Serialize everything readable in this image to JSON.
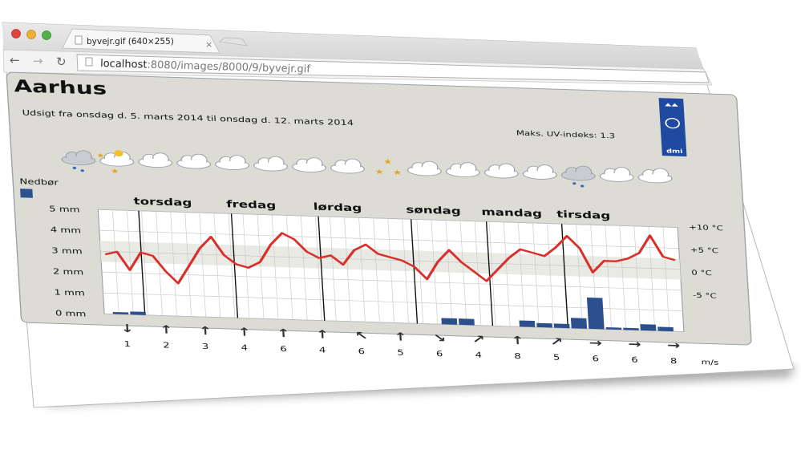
{
  "browser": {
    "tab_title": "byvejr.gif (640×255)",
    "tab_close": "×",
    "url_host": "localhost",
    "url_path": ":8080/images/8000/9/byvejr.gif"
  },
  "forecast": {
    "city": "Aarhus",
    "subtitle": "Udsigt fra onsdag d. 5. marts 2014 til onsdag d. 12. marts 2014",
    "uv": "Maks. UV-indeks: 1.3",
    "logo_text": "dmi",
    "precip_label": "Nedbør",
    "wind_unit": "m/s",
    "days": [
      "torsdag",
      "fredag",
      "lørdag",
      "søndag",
      "mandag",
      "tirsdag"
    ],
    "weather_icons": [
      "rain-cloud-icon",
      "moon-cloud-icon",
      "cloud-icon",
      "cloud-icon",
      "cloud-icon",
      "cloud-icon",
      "cloud-icon",
      "cloud-icon",
      "stars-icon",
      "cloud-icon",
      "cloud-icon",
      "cloud-icon",
      "cloud-icon",
      "rain-cloud-icon",
      "cloud-icon",
      "cloud-icon"
    ],
    "colors": {
      "temp_line": "#d9302c",
      "precip_bar": "#2c4f8e",
      "panel": "#dcdcd5",
      "logo_bg": "#1f4aa0"
    }
  },
  "chart_data": {
    "type": "bar",
    "title": "",
    "left_axis": {
      "label": "Nedbør",
      "ticks": [
        "5 mm",
        "4 mm",
        "3 mm",
        "2 mm",
        "1 mm",
        "0 mm"
      ],
      "range": [
        0,
        5
      ]
    },
    "right_axis": {
      "ticks": [
        "+10 °C",
        "+5 °C",
        "0 °C",
        "-5 °C"
      ],
      "range": [
        -7.5,
        10
      ]
    },
    "precipitation_mm": [
      0,
      0.1,
      0,
      0.15,
      0,
      0,
      0,
      0,
      0,
      0,
      0,
      0,
      0,
      0,
      0,
      0,
      0,
      0,
      0,
      0,
      0,
      0,
      0,
      0,
      0,
      0,
      0,
      0,
      0,
      0,
      0,
      0,
      0,
      0,
      0,
      0,
      0,
      0,
      0,
      0.3,
      0,
      0.3,
      0,
      0,
      0,
      0,
      0,
      0,
      0.3,
      0,
      0.2,
      0,
      0.2,
      0,
      0.5,
      0,
      1.5,
      0,
      0.1,
      0,
      0.1,
      0,
      0.3,
      0,
      0.2,
      0,
      0
    ],
    "series": [
      {
        "name": "temperature",
        "values": [
          2.5,
          3,
          0,
          3,
          2.5,
          0,
          -2,
          1,
          4,
          6,
          3,
          1.5,
          1,
          2,
          5,
          7,
          6,
          4,
          3,
          3.5,
          2,
          4.5,
          5.5,
          4,
          3.5,
          3,
          2,
          0,
          3,
          5,
          3,
          1.5,
          0,
          2,
          4,
          5.5,
          5,
          4.5,
          6,
          8,
          6,
          2,
          4,
          4,
          4.5,
          5.5,
          8.5,
          5,
          4.5
        ]
      }
    ],
    "wind": [
      {
        "dir": "↓",
        "speed": "1"
      },
      {
        "dir": "↑",
        "speed": "2"
      },
      {
        "dir": "↑",
        "speed": "3"
      },
      {
        "dir": "↑",
        "speed": "4"
      },
      {
        "dir": "↑",
        "speed": "6"
      },
      {
        "dir": "↑",
        "speed": "4"
      },
      {
        "dir": "↖",
        "speed": "6"
      },
      {
        "dir": "↑",
        "speed": "5"
      },
      {
        "dir": "↘",
        "speed": "6"
      },
      {
        "dir": "↗",
        "speed": "4"
      },
      {
        "dir": "↑",
        "speed": "8"
      },
      {
        "dir": "↗",
        "speed": "5"
      },
      {
        "dir": "→",
        "speed": "6"
      },
      {
        "dir": "→",
        "speed": "6"
      },
      {
        "dir": "→",
        "speed": "8"
      }
    ]
  }
}
